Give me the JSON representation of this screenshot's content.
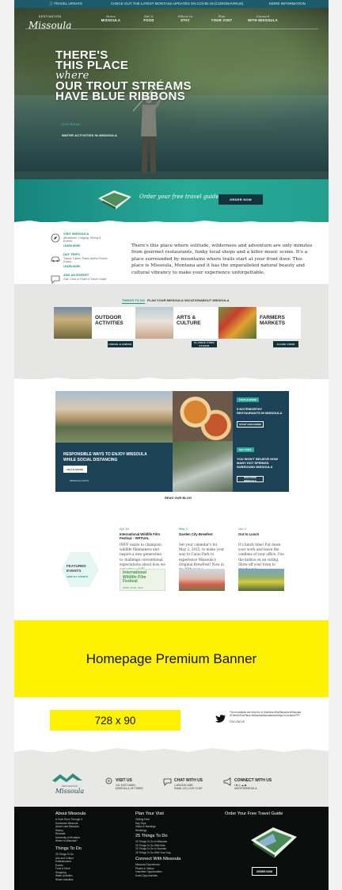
{
  "alert": {
    "label": "TRAVEL UPDATE",
    "message": "CHECK OUT THE LATEST MONTANA UPDATES ON COVID-19 (CORONAVIRUS).",
    "more": "MORE INFORMATION"
  },
  "logo": {
    "small": "DESTINATION",
    "big": "Missoula"
  },
  "nav": [
    {
      "l1": "Home",
      "l2": "MISSOULA"
    },
    {
      "l1": "Eat &",
      "l2": "FOOD"
    },
    {
      "l1": "Where to",
      "l2": "STAY"
    },
    {
      "l1": "Plan",
      "l2": "YOUR VISIT"
    },
    {
      "l1": "Connect",
      "l2": "WITH MISSOULA"
    }
  ],
  "hero": {
    "line1": "THERE'S",
    "line2": "THIS PLACE",
    "line3": "where",
    "line4": "OUR TROUT STREAMS",
    "line5": "HAVE BLUE RIBBONS",
    "tag_kicker": "EXPLORE ALL",
    "tag_text": "WATER ACTIVITIES IN MISSOULA"
  },
  "guide": {
    "text": "Order your free travel guide.",
    "button": "ORDER NOW"
  },
  "intro_links": [
    {
      "title": "VISIT MISSOULA",
      "desc": "Attractions, Lodging, Dining & Events",
      "more": "LEARN MORE"
    },
    {
      "title": "DAY TRIPS",
      "desc": "Towns, Lakes, Parks and/or Scenic Drives",
      "more": "LEARN MORE"
    },
    {
      "title": "ASK AN EXPERT",
      "desc": "Call, Chat or Order A Travel Guide",
      "more": "LEARN MORE"
    }
  ],
  "intro": {
    "paragraph": "There's this place where solitude, wilderness and adventure are only minutes from gourmet restaurants, funky local shops and a killer music scene. It's a place surrounded by mountains where trails start at your front door. This place is Missoula, Montana and it has the unparalleled natural beauty and cultural vibrancy to make your experience unforgettable."
  },
  "tabs": [
    "THINGS TO DO",
    "PLAN YOUR MISSOULA VACATION",
    "ABOUT MISSOULA"
  ],
  "categories": [
    {
      "label1": "OUTDOOR",
      "label2": "ACTIVITIES",
      "link": "HIKING & BIKING"
    },
    {
      "label1": "ARTS &",
      "label2": "CULTURE",
      "link": "CLASSIC FORK STUDIO"
    },
    {
      "label1": "FARMERS",
      "label2": "MARKETS",
      "link": "CLARK FORK"
    }
  ],
  "features": {
    "main_title": "RESPONSIBLE WAYS TO ENJOY MISSOULA WHILE SOCIAL DISTANCING",
    "main_button": "READ MORE",
    "main_sub": "MISSOULA SAYS",
    "box1_kicker": "FOOD & DRINK",
    "box1_title": "5 NOTEWORTHY RESTAURANTS IN MISSOULA",
    "box1_button": "START EXPLORING",
    "box2_kicker": "DAY TRIPS",
    "box2_title": "YOU WON'T BELIEVE HOW MANY HOT SPRINGS SURROUND MISSOULA",
    "box2_button": "DISCOVER MISSOULA",
    "read_blog": "READ OUR BLOG"
  },
  "events": {
    "heading1": "FEATURED",
    "heading2": "EVENTS",
    "sub": "VIEW ALL EVENTS",
    "items": [
      {
        "date": "Apr 18",
        "title": "International Wildlife Film Festival - VIRTUAL",
        "desc": "IWFF exists to champion wildlife filmmakers and inspire a new generation to challenge conventional expectations about how we conserve wildli...",
        "img_l1": "International",
        "img_l2": "Wildlife Film",
        "img_l3": "Festival",
        "img_date": "APRIL 18-25, 2020"
      },
      {
        "date": "May 2",
        "title": "Garden City Brewfest",
        "desc": "Set your calendar's for May 2, 2015, to make your way to Caras Park to experience Missoula's Original BrewFest! Now in its 28th year o..."
      },
      {
        "date": "Jun 3",
        "title": "Out to Lunch",
        "desc": "It's lunch time! Put down your work and leave the confines of your office. Use the kiddos on an outing. Show off your town to guest a rol..."
      }
    ]
  },
  "ads": {
    "premium": "Homepage Premium Banner",
    "leaderboard": "728 x 90"
  },
  "tweet": {
    "text": "The mountains are blue fun in Montana #DoMissoula #Missoula #ThereIsThisPlace #MountainWonderland https://t.co/xtmb7PY",
    "follow": "FOLLOW US"
  },
  "footer_contact": [
    {
      "title": "VISIT US",
      "l1": "101 EAST MAIN",
      "l2": "MISSOULA, MT 59802"
    },
    {
      "title": "CHAT WITH US",
      "l1": "1.800.526.3465",
      "l2": "EMAIL US | LIVE CHAT"
    },
    {
      "title": "CONNECT WITH US",
      "l1": "f  ■  ◎  ☁  ▶",
      "l2": "#DESTMISSOULA"
    }
  ],
  "footer": {
    "col1_h": "About Missoula",
    "col1_items": [
      "A Town Runs Through It",
      "Downtown Missoula",
      "About Lake Missoula",
      "History",
      "Relocate",
      "University of Montana",
      "Where is Missoula?"
    ],
    "col1b_h": "Things To Do",
    "col1b_items": [
      "25 Things To Do",
      "Arts and Culture",
      "Entertainment",
      "Events",
      "Food & Drink",
      "Shopping",
      "Water Activities",
      "Winter Activities"
    ],
    "col2_h": "Plan Your Visit",
    "col2_items": [
      "Getting Here",
      "Day Trips",
      "Visitor & Meetings",
      "Weddings"
    ],
    "col2b_h": "25 Things To Do",
    "col2b_items": [
      "25 Things To Do in Missoula",
      "25 Things To Do With Kids",
      "25 Things To Do in Summer",
      "25 Things To Do With Your Dog"
    ],
    "col2c_h": "Connect With Missoula",
    "col2c_items": [
      "Missoula Experiences",
      "Photos & Videos",
      "Volunteer Opportunities",
      "Event Opportunities"
    ],
    "col3_h": "Order Your Free Travel Guide",
    "col3_btn": "ORDER NOW"
  },
  "colors": {
    "teal": "#17947f",
    "navy": "#1c4258",
    "yellow": "#fff200"
  }
}
